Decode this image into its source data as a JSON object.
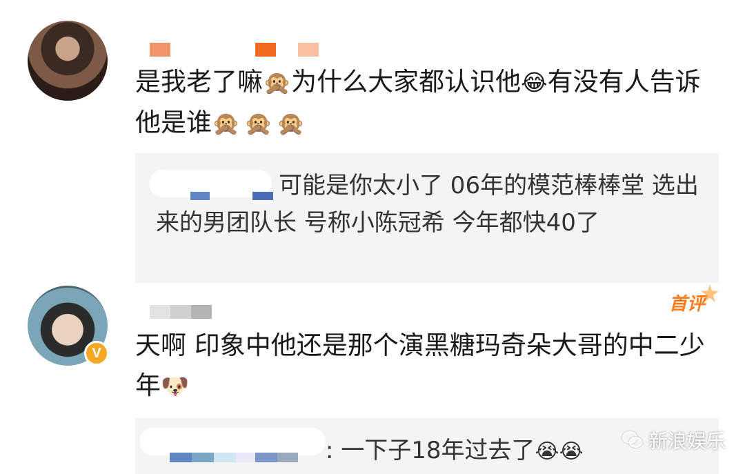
{
  "comments": [
    {
      "text_part1": "是我老了嘛",
      "emoji1": "🙊",
      "text_part2": "为什么大家都认识他",
      "emoji2": "😂",
      "text_part3": "有没有人告诉他是谁",
      "emoji3": "🙊🙊🙊",
      "reply_text": "可能是你太小了 06年的模范棒棒堂 选出来的男团队长 号称小陈冠希 今年都快40了"
    },
    {
      "badge": "首评",
      "verified_symbol": "V",
      "text": "天啊 印象中他还是那个演黑糖玛奇朵大哥的中二少年",
      "emoji": "🐶",
      "reply_text": ": 一下子18年过去了",
      "reply_emoji": "😭😭"
    }
  ],
  "watermark": "新浪娱乐",
  "colors": {
    "orange_badge": "#ff7a1a",
    "verified": "#f5a623",
    "reply_bg": "#f4f4f4"
  }
}
